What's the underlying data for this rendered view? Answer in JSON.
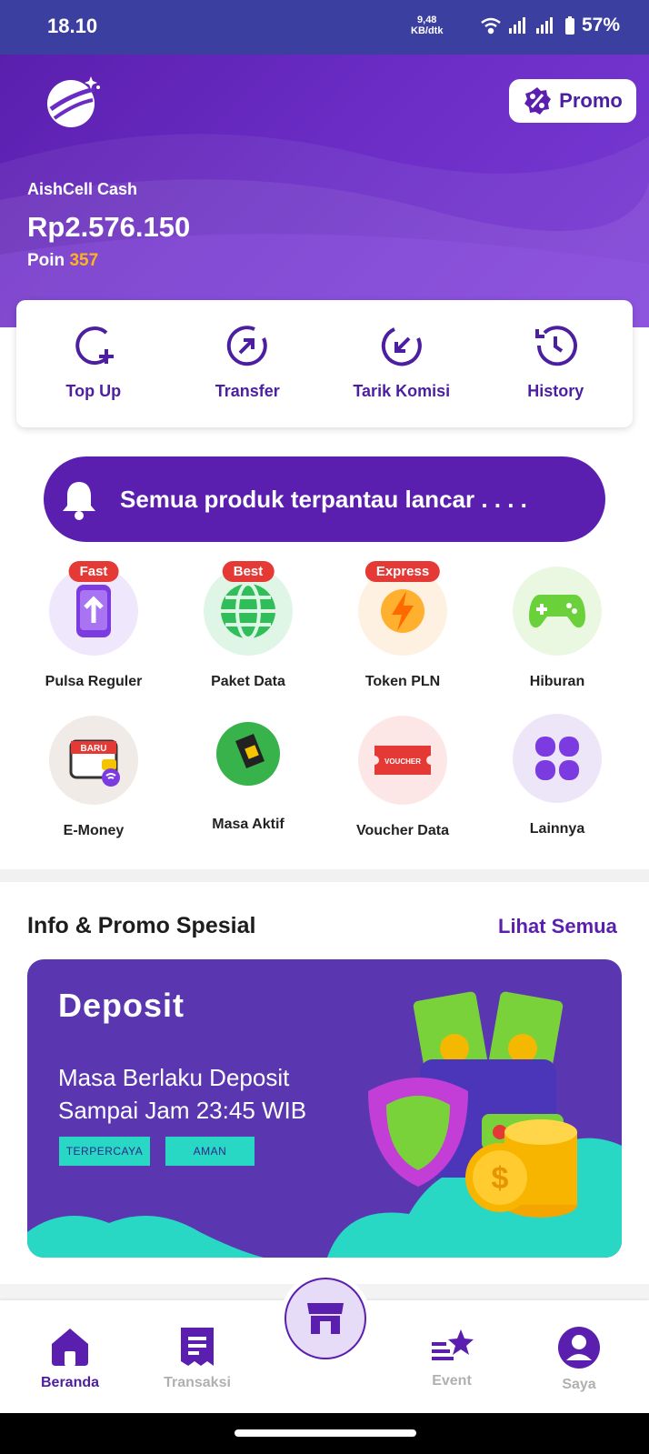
{
  "status_bar": {
    "time": "18.10",
    "net_speed_value": "9,48",
    "net_speed_unit": "KB/dtk",
    "battery": "57%"
  },
  "header": {
    "promo_label": "Promo",
    "balance_label": "AishCell Cash",
    "balance": "Rp2.576.150",
    "poin_label": "Poin",
    "poin_value": "357"
  },
  "actions": [
    {
      "label": "Top Up",
      "icon": "top-up-icon"
    },
    {
      "label": "Transfer",
      "icon": "transfer-icon"
    },
    {
      "label": "Tarik Komisi",
      "icon": "withdraw-icon"
    },
    {
      "label": "History",
      "icon": "history-icon"
    }
  ],
  "notice": {
    "text": "Semua produk terpantau lancar . . . ."
  },
  "products": [
    {
      "label": "Pulsa Reguler",
      "badge": "Fast",
      "icon": "phone-upload-icon"
    },
    {
      "label": "Paket Data",
      "badge": "Best",
      "icon": "globe-icon"
    },
    {
      "label": "Token PLN",
      "badge": "Express",
      "icon": "lightning-icon"
    },
    {
      "label": "Hiburan",
      "badge": "",
      "icon": "gamepad-icon"
    },
    {
      "label": "E-Money",
      "badge": "",
      "icon": "wallet-icon",
      "inner_label": "BARU"
    },
    {
      "label": "Masa Aktif",
      "badge": "",
      "icon": "sim-card-icon"
    },
    {
      "label": "Voucher Data",
      "badge": "",
      "icon": "voucher-icon",
      "inner_label": "VOUCHER"
    },
    {
      "label": "Lainnya",
      "badge": "",
      "icon": "grid-more-icon"
    }
  ],
  "info": {
    "title": "Info & Promo Spesial",
    "link": "Lihat Semua",
    "banner": {
      "title": "Deposit",
      "line1": "Masa Berlaku Deposit",
      "line2": "Sampai Jam 23:45 WIB",
      "tag1": "TERPERCAYA",
      "tag2": "AMAN"
    }
  },
  "bottom_nav": [
    {
      "label": "Beranda",
      "active": true
    },
    {
      "label": "Transaksi",
      "active": false
    },
    {
      "label": "Event",
      "active": false
    },
    {
      "label": "Saya",
      "active": false
    }
  ],
  "colors": {
    "primary": "#5a1fae",
    "accent_yellow": "#ffb21e",
    "badge_red": "#e53935",
    "teal": "#28d7c4"
  }
}
